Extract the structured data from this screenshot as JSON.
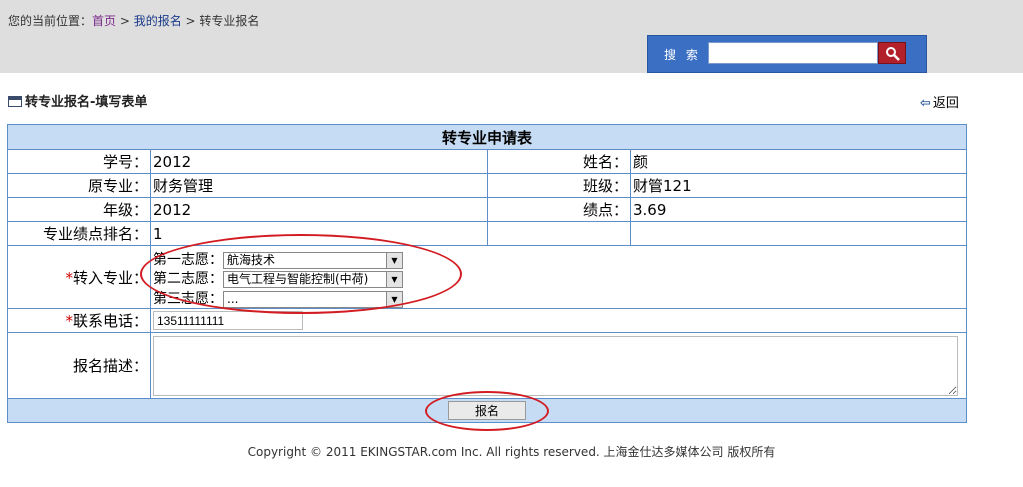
{
  "breadcrumb": {
    "prefix": "您的当前位置：",
    "home": "首页",
    "sep1": " > ",
    "mine": "我的报名",
    "sep2": " > ",
    "current": "转专业报名"
  },
  "search": {
    "label": "搜 索",
    "value": ""
  },
  "form_title": "转专业报名-填写表单",
  "back_label": "返回",
  "table": {
    "title": "转专业申请表",
    "student_id_label": "学号：",
    "student_id": "2012",
    "name_label": "姓名：",
    "name": "颜",
    "major_label": "原专业：",
    "major": "财务管理",
    "class_label": "班级：",
    "class": "财管121",
    "grade_label": "年级：",
    "grade": "2012",
    "gpa_label": "绩点：",
    "gpa": "3.69",
    "rank_label": "专业绩点排名：",
    "rank": "1",
    "transfer_label_star": "*",
    "transfer_label": "转入专业：",
    "choices": [
      {
        "label": "第一志愿：",
        "value": "航海技术"
      },
      {
        "label": "第二志愿：",
        "value": "电气工程与智能控制(中荷)"
      },
      {
        "label": "第三志愿：",
        "value": "..."
      }
    ],
    "phone_label_star": "*",
    "phone_label": "联系电话：",
    "phone": "13511111111",
    "desc_label": "报名描述：",
    "submit": "报名"
  },
  "copyright": "Copyright © 2011 EKINGSTAR.com Inc. All rights reserved. 上海金仕达多媒体公司 版权所有",
  "colors": {
    "header_bg": "#c6dcf4",
    "border": "#5e8ec8",
    "required": "#cc0000",
    "annotation": "#d21c22",
    "search_bg": "#3a6fc4"
  }
}
